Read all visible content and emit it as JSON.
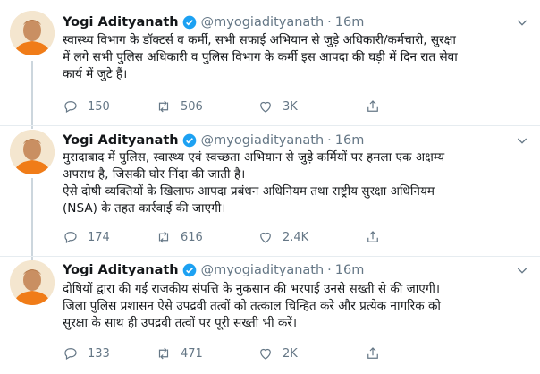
{
  "tweets": [
    {
      "name": "Yogi Adityanath",
      "handle": "@myogiadityanath",
      "dot": "·",
      "time": "16m",
      "lines": [
        "स्वास्थ्य विभाग के डॉक्टर्स व कर्मी, सभी सफाई अभियान से जुड़े अधिकारी/कर्मचारी, सुरक्षा",
        "में लगे सभी पुलिस अधिकारी व पुलिस विभाग के कर्मी इस आपदा की घड़ी में दिन रात सेवा",
        "कार्य में जुटे हैं।"
      ],
      "replies": "150",
      "retweets": "506",
      "likes": "3K"
    },
    {
      "name": "Yogi Adityanath",
      "handle": "@myogiadityanath",
      "dot": "·",
      "time": "16m",
      "lines": [
        "मुरादाबाद में पुलिस, स्वास्थ्य एवं स्वच्छता अभियान से जुड़े कर्मियों पर हमला एक अक्षम्य",
        "अपराध है, जिसकी घोर निंदा की जाती है।",
        "ऐसे दोषी व्यक्तियों के खिलाफ आपदा प्रबंधन अधिनियम तथा राष्ट्रीय सुरक्षा अधिनियम",
        "(NSA) के तहत कार्रवाई की जाएगी।"
      ],
      "replies": "174",
      "retweets": "616",
      "likes": "2.4K"
    },
    {
      "name": "Yogi Adityanath",
      "handle": "@myogiadityanath",
      "dot": "·",
      "time": "16m",
      "lines": [
        "दोषियों द्वारा की गई राजकीय संपत्ति के नुकसान की भरपाई उनसे सख्ती से की जाएगी।",
        "जिला पुलिस प्रशासन ऐसे उपद्रवी तत्वों को तत्काल चिन्हित करे और प्रत्येक नागरिक को",
        "सुरक्षा के साथ ही उपद्रवी तत्वों पर पूरी सख्ती भी करें।"
      ],
      "replies": "133",
      "retweets": "471",
      "likes": "2K"
    }
  ],
  "colors": {
    "verified": "#1da1f2",
    "muted": "#657786",
    "text": "#14171a",
    "border": "#e6ecf0",
    "thread": "#ccd6dd"
  },
  "icons": [
    "verified-badge-icon",
    "chevron-down-icon",
    "reply-icon",
    "retweet-icon",
    "like-icon",
    "share-icon"
  ]
}
